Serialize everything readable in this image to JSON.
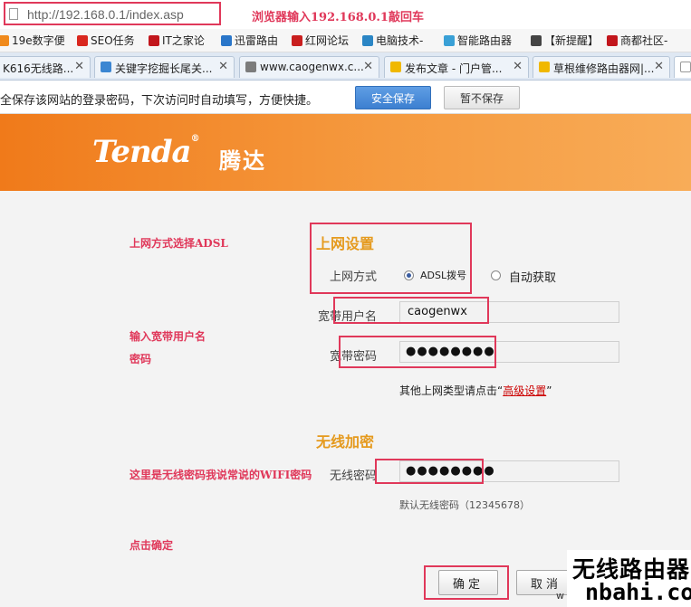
{
  "address_bar": {
    "url": "http://192.168.0.1/index.asp",
    "annotation": "浏览器输入192.168.0.1敲回车"
  },
  "bookmarks": [
    {
      "label": "19e数字便",
      "icon": "globe-icon",
      "color": "#f08a1c"
    },
    {
      "label": "SEO任务",
      "icon": "seo-icon",
      "color": "#d9271e"
    },
    {
      "label": "IT之家论",
      "icon": "it-icon",
      "color": "#c2161c"
    },
    {
      "label": "迅雷路由",
      "icon": "thunder-icon",
      "color": "#2a76c9"
    },
    {
      "label": "红网论坛",
      "icon": "forum-icon",
      "color": "#c91f1f"
    },
    {
      "label": "电脑技术-",
      "icon": "gear-icon",
      "color": "#2b86c5"
    },
    {
      "label": "智能路由器",
      "icon": "router-icon",
      "color": "#39a0d6"
    },
    {
      "label": "【新提醒】",
      "icon": "bell-icon",
      "color": "#444444"
    },
    {
      "label": "商都社区-",
      "icon": "shop-icon",
      "color": "#c2161c"
    }
  ],
  "tabs": [
    {
      "label": "K616无线路...",
      "icon": "",
      "color": "#dfe8f3"
    },
    {
      "label": "关键字挖掘长尾关...",
      "icon": "page-icon",
      "color": "#3b86d2"
    },
    {
      "label": "www.caogenwx.c...",
      "icon": "page-icon",
      "color": "#7c7c7c"
    },
    {
      "label": "发布文章 - 门户管...",
      "icon": "message-icon",
      "color": "#f0b800"
    },
    {
      "label": "草根维修路由器网|...",
      "icon": "message-icon",
      "color": "#f0b800"
    }
  ],
  "password_prompt": {
    "text": "全保存该网站的登录密码，下次访问时自动填写，方便快捷。",
    "save_label": "安全保存",
    "no_save_label": "暂不保存"
  },
  "brand": {
    "logo_text": "Tenda",
    "logo_cn": "腾达"
  },
  "internet": {
    "section_title": "上网设置",
    "mode_label": "上网方式",
    "mode_options": [
      {
        "label": "ADSL拨号",
        "checked": true
      },
      {
        "label": "自动获取",
        "checked": false
      }
    ],
    "username_label": "宽带用户名",
    "username_value": "caogenwx",
    "password_label": "宽带密码",
    "password_mask": "●●●●●●●●",
    "advanced_prefix": "其他上网类型请点击“",
    "advanced_link": "高级设置",
    "advanced_suffix": "”"
  },
  "wireless": {
    "section_title": "无线加密",
    "password_label": "无线密码",
    "password_mask": "●●●●●●●●",
    "default_hint": "默认无线密码（12345678）"
  },
  "actions": {
    "ok_label": "确定",
    "cancel_label": "取消"
  },
  "annotations": {
    "adsl": "上网方式选择ADSL",
    "user_line1": "输入宽带用户名",
    "user_line2": "密码",
    "wifi": "这里是无线密码我说常说的WIFI密码",
    "confirm": "点击确定"
  },
  "watermark": {
    "cn": "无线路由器",
    "en": "nbahi.com",
    "small": "w"
  },
  "colors": {
    "accent_red": "#e0385a",
    "brand_orange": "#f07a1a",
    "section_orange": "#e59a1e",
    "save_blue": "#3c7fd0"
  }
}
